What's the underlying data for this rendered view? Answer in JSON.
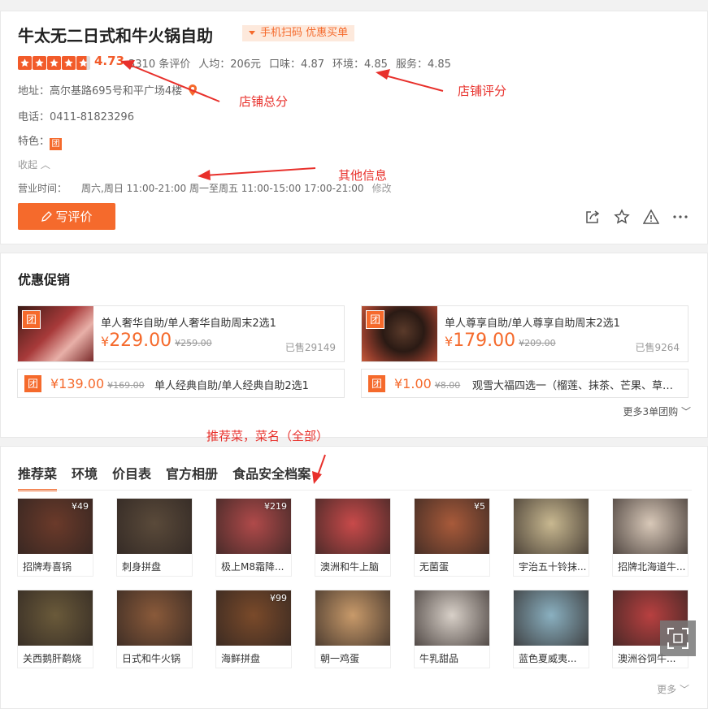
{
  "shop": {
    "name": "牛太无二日式和牛火锅自助",
    "scan_badge": "手机扫码 优惠买单",
    "rating": "4.73",
    "stats": [
      "3310 条评价",
      "人均：206元",
      "口味：4.87",
      "环境：4.85",
      "服务：4.85"
    ],
    "address_label": "地址：",
    "address": "高尔基路695号和平广场4楼",
    "phone_label": "电话：",
    "phone": "0411-81823296",
    "feature_label": "特色：",
    "feature_badge": "团",
    "collapse_label": "收起",
    "hours_label": "营业时间：",
    "hours": "周六,周日 11:00-21:00 周一至周五 11:00-15:00 17:00-21:00",
    "edit_label": "修改",
    "write_review": "写评价",
    "star_rating_fraction": 0.946
  },
  "annotations": {
    "total_score": "店铺总分",
    "shop_score": "店铺评分",
    "other_info": "其他信息",
    "dish_note": "推荐菜，菜名（全部）"
  },
  "promotions": {
    "title": "优惠促销",
    "badge": "团",
    "deals": [
      {
        "name": "单人奢华自助/单人奢华自助周末2选1",
        "currency": "¥",
        "price": "229.00",
        "original": "¥259.00",
        "sold": "已售29149"
      },
      {
        "name": "单人尊享自助/单人尊享自助周末2选1",
        "currency": "¥",
        "price": "179.00",
        "original": "¥209.00",
        "sold": "已售9264"
      }
    ],
    "small_deals": [
      {
        "price": "¥139.00",
        "original": "¥169.00",
        "name": "单人经典自助/单人经典自助2选1"
      },
      {
        "price": "¥1.00",
        "original": "¥8.00",
        "name": "观雪大福四选一（榴莲、抹茶、芒果、草莓）"
      }
    ],
    "more": "更多3单团购"
  },
  "dishes": {
    "tabs": [
      "推荐菜",
      "环境",
      "价目表",
      "官方相册",
      "食品安全档案"
    ],
    "items": [
      {
        "name": "招牌寿喜锅",
        "price": "¥49",
        "color": "#6b3a2a"
      },
      {
        "name": "刺身拼盘",
        "price": "",
        "color": "#5a4a3a"
      },
      {
        "name": "极上M8霜降...",
        "price": "¥219",
        "color": "#b04a4a"
      },
      {
        "name": "澳洲和牛上脑",
        "price": "",
        "color": "#c84a4a"
      },
      {
        "name": "无菌蛋",
        "price": "¥5",
        "color": "#a85a3a"
      },
      {
        "name": "宇治五十铃抹...",
        "price": "",
        "color": "#c8b890"
      },
      {
        "name": "招牌北海道牛...",
        "price": "",
        "color": "#d8c8b8"
      },
      {
        "name": "关西鹅肝鹬烧",
        "price": "",
        "color": "#6a5a3a"
      },
      {
        "name": "日式和牛火锅",
        "price": "",
        "color": "#8a5a3a"
      },
      {
        "name": "海鲜拼盘",
        "price": "¥99",
        "color": "#7a4a2a"
      },
      {
        "name": "朝一鸡蛋",
        "price": "",
        "color": "#c89a6a"
      },
      {
        "name": "牛乳甜品",
        "price": "",
        "color": "#d8d0c8"
      },
      {
        "name": "蓝色夏威夷...",
        "price": "",
        "color": "#8ab0c0"
      },
      {
        "name": "澳洲谷饲牛...",
        "price": "",
        "color": "#b84040"
      }
    ],
    "more": "更多"
  },
  "colors": {
    "accent": "#f56a2c",
    "annotation": "#e8302b"
  }
}
